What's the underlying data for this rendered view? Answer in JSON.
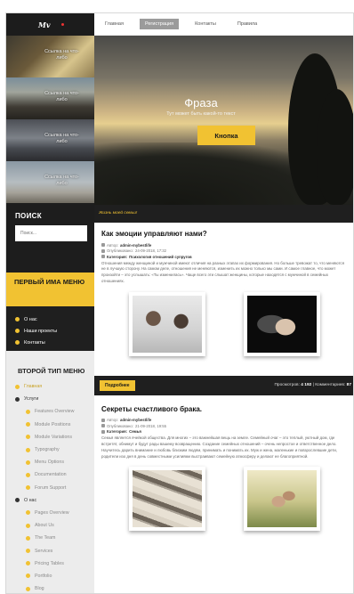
{
  "logo": "Mv",
  "sidebar": {
    "thumbs": [
      "Ссылка на что-либо",
      "Ссылка на что-либо",
      "Ссылка на что-либо",
      "Ссылка на что-либо"
    ],
    "search": {
      "title": "ПОИСК",
      "placeholder": "Поиск..."
    },
    "menu1": {
      "title": "ПЕРВЫЙ ИМА МЕНЮ",
      "items": [
        "О нас",
        "Наши проекты",
        "Контакты"
      ]
    },
    "menu2": {
      "title": "ВТОРОЙ ТИП МЕНЮ",
      "items": [
        {
          "label": "Главная"
        },
        {
          "label": "Услуги"
        },
        {
          "label": "Features Overview"
        },
        {
          "label": "Module Positions"
        },
        {
          "label": "Module Variations"
        },
        {
          "label": "Typography"
        },
        {
          "label": "Menu Options"
        },
        {
          "label": "Documentation"
        },
        {
          "label": "Forum Support"
        },
        {
          "label": "О нас"
        },
        {
          "label": "Pages Overview"
        },
        {
          "label": "About Us"
        },
        {
          "label": "The Team"
        },
        {
          "label": "Services"
        },
        {
          "label": "Pricing Tables"
        },
        {
          "label": "Portfolio"
        },
        {
          "label": "Blog"
        }
      ]
    }
  },
  "nav": {
    "items": [
      "Главная",
      "Регистрация",
      "Контакты",
      "Правила"
    ],
    "active": "Регистрация"
  },
  "hero": {
    "title": "Фраза",
    "subtitle": "Тут может быть какой-то текст",
    "button": "Кнопка"
  },
  "quote": "Жизнь моей семьи!",
  "articles": [
    {
      "title": "Как эмоции управляют нами?",
      "author_label": "Автор:",
      "author": "admin-mybestlife",
      "date_label": "Опубликовано:",
      "date": "24-09-2018, 17:32",
      "category_label": "Категория:",
      "category": "Психология отношений супругов",
      "text": "Отношения между женщиной и мужчиной имеют отличия на разных этапах их формирования. Но больше тревожат то, что меняются не в лучшую сторону. На самом деле, отношения не меняются, изменить их можно только мы сами. И самое главное, что может произойти – это услышать: «Ты изменилась». Чаще всего эти слышат женщины, которые находятся с мужчиной в семейных отношениях.",
      "more_button": "Подробнее",
      "views_label": "Просмотров:",
      "views": "4 192",
      "comments_label": "Комментариев:",
      "comments": "87"
    },
    {
      "title": "Секреты счастливого брака.",
      "author_label": "Автор:",
      "author": "admin-mybestlife",
      "date_label": "Опубликовано:",
      "date": "21-09-2018, 19:55",
      "category_label": "Категория:",
      "category": "Семья",
      "text": "Семья является ячейкой общества. Для многих – это важнейшая вещь на земле. Семейный очаг – это теплый, уютный дом, где встретят, обнимут и будут рады вашему возвращению. Создание семейных отношений – очень непростое и ответственное дело. Научитесь дарить внимание и любовь близким людям, принимать и понимать их. Муж и жена, маленькие и повзрослевшие дети, родители изо дня в день совместными усилиями выстраивают семейную атмосферу и делают ее благоприятной."
    }
  ]
}
